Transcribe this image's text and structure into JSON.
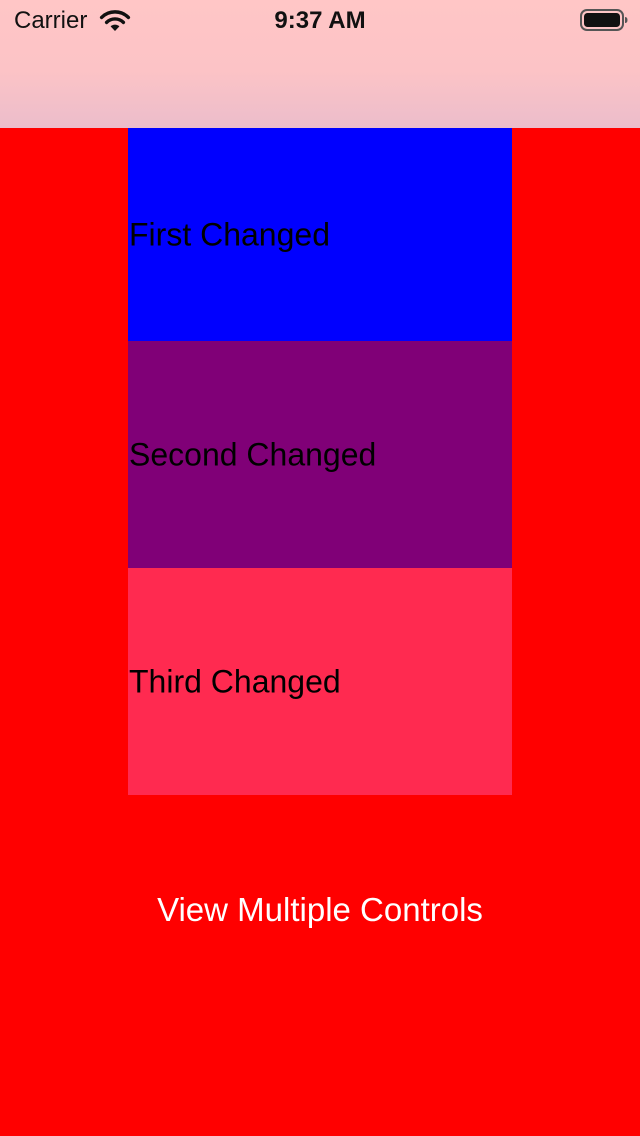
{
  "colors": {
    "background": "#ff0000",
    "nav_bar": "#ffc6c6",
    "button_text": "#ffffff"
  },
  "status_bar": {
    "carrier": "Carrier",
    "time": "9:37 AM",
    "wifi_icon": "wifi-icon",
    "battery_icon": "battery-icon"
  },
  "boxes": [
    {
      "label": "First Changed",
      "color": "#0000ff"
    },
    {
      "label": "Second Changed",
      "color": "#800077"
    },
    {
      "label": "Third Changed",
      "color": "#ff2a50"
    }
  ],
  "button": {
    "label": "View Multiple Controls"
  }
}
